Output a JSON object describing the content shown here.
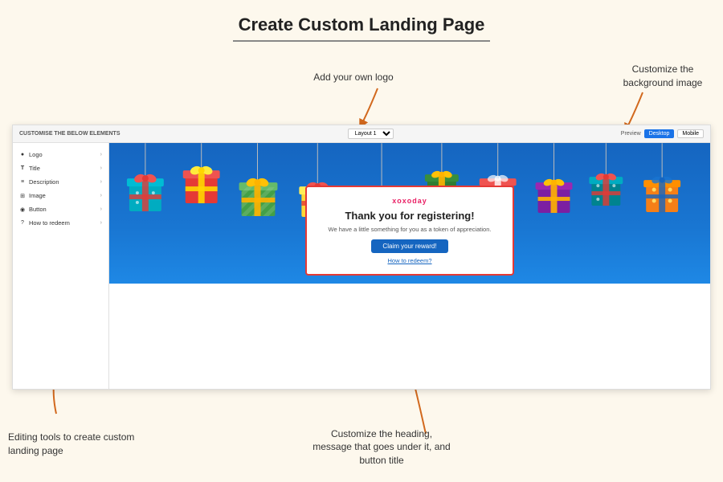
{
  "page": {
    "title": "Create Custom Landing Page",
    "bg_color": "#fdf8ed"
  },
  "annotations": {
    "logo": "Add your own logo",
    "background_image": "Customize the\nbackground image",
    "editing_tools": "Editing tools to create custom landing page",
    "customize_heading": "Customize the heading,\nmessage that goes under it, and\nbutton title"
  },
  "ui": {
    "topbar": {
      "left_label": "CUSTOMISE THE BELOW ELEMENTS",
      "layout_label": "Layout 1",
      "preview_label": "Preview",
      "desktop_label": "Desktop",
      "mobile_label": "Mobile"
    },
    "sidebar": {
      "items": [
        {
          "icon": "●",
          "label": "Logo"
        },
        {
          "icon": "T",
          "label": "Title"
        },
        {
          "icon": "≡",
          "label": "Description"
        },
        {
          "icon": "⊞",
          "label": "Image"
        },
        {
          "icon": "◉",
          "label": "Button"
        },
        {
          "icon": "?",
          "label": "How to redeem"
        }
      ]
    },
    "landing_card": {
      "logo": "xoxoday",
      "heading": "Thank you for registering!",
      "subtext": "We have a little something for you as a token of appreciation.",
      "button_label": "Claim your reward!",
      "link_label": "How to redeem?"
    }
  }
}
